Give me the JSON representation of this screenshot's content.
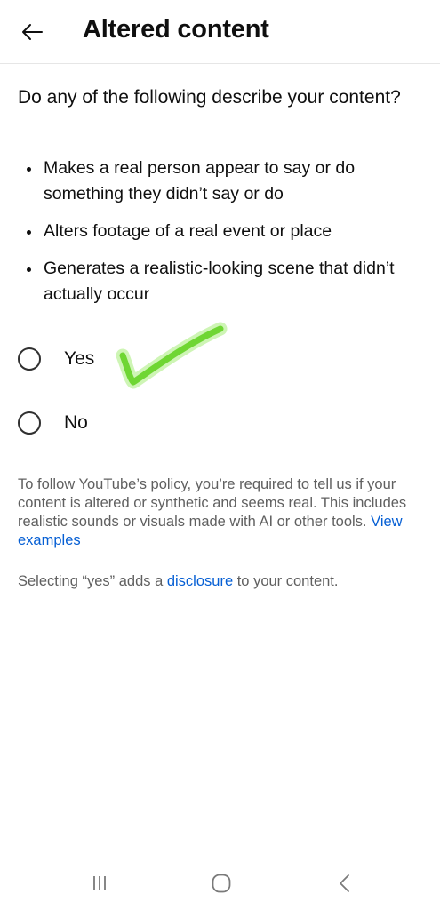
{
  "header": {
    "title": "Altered content",
    "back_icon": "arrow-left-icon"
  },
  "question": "Do any of the following describe your content?",
  "bullets": [
    "Makes a real person appear to say or do something they didn’t say or do",
    "Alters footage of a real event or place",
    "Generates a realistic-looking scene that didn’t actually occur"
  ],
  "options": [
    {
      "label": "Yes",
      "selected": false
    },
    {
      "label": "No",
      "selected": false
    }
  ],
  "annotation": {
    "type": "hand-drawn-checkmark",
    "color": "#7ddc3a"
  },
  "policy": {
    "text": "To follow YouTube’s policy, you’re required to tell us if your content is altered or synthetic and seems real. This includes realistic sounds or visuals made with AI or other tools.",
    "link": "View examples"
  },
  "selecting": {
    "before": "Selecting “yes” adds a ",
    "link": "disclosure",
    "after": " to your content."
  },
  "colors": {
    "link": "#065fd4",
    "secondary_text": "#606060",
    "primary_text": "#0f0f0f"
  },
  "system_nav": {
    "recents_icon": "recent-apps-icon",
    "home_icon": "home-icon",
    "back_icon": "back-chevron-icon"
  }
}
